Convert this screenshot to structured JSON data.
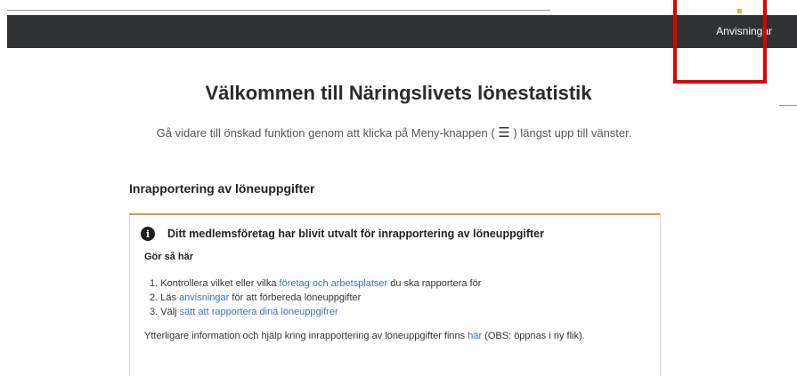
{
  "header": {
    "nav_link": "Anvisningar",
    "accent_color": "#e5b53a",
    "bar_color": "#2f3133"
  },
  "highlight": {
    "color": "#e00000"
  },
  "main": {
    "title": "Välkommen till Näringslivets lönestatistik",
    "subtitle_before": "Gå vidare till önskad funktion genom att klicka på Meny-knappen (",
    "menu_glyph": "☰",
    "subtitle_after": ") längst upp till vänster.",
    "section_heading": "Inrapportering av löneuppgifter"
  },
  "card": {
    "accent_color": "#e8914a",
    "icon": "info-icon",
    "alert": "Ditt medlemsföretag har blivit utvalt för inrapportering av löneuppgifter",
    "howto": "Gör så här",
    "steps": [
      {
        "num": "1.",
        "before": "Kontrollera vilket eller vilka",
        "link": "företag och arbetsplatser",
        "after": "du ska rapportera för"
      },
      {
        "num": "2.",
        "before": "Läs",
        "link": "anvisningar",
        "after": "för att förbereda löneuppgifter"
      },
      {
        "num": "3.",
        "before": "Välj",
        "link": "sätt att rapportera dina löneuppgifrer",
        "after": ""
      }
    ],
    "more_before": "Ytterligare information och hjälp kring inrapportering av löneuppgifter finns",
    "more_link": "här",
    "more_after": "(OBS: öppnas i ny flik).",
    "link_color": "#3b73b9"
  }
}
